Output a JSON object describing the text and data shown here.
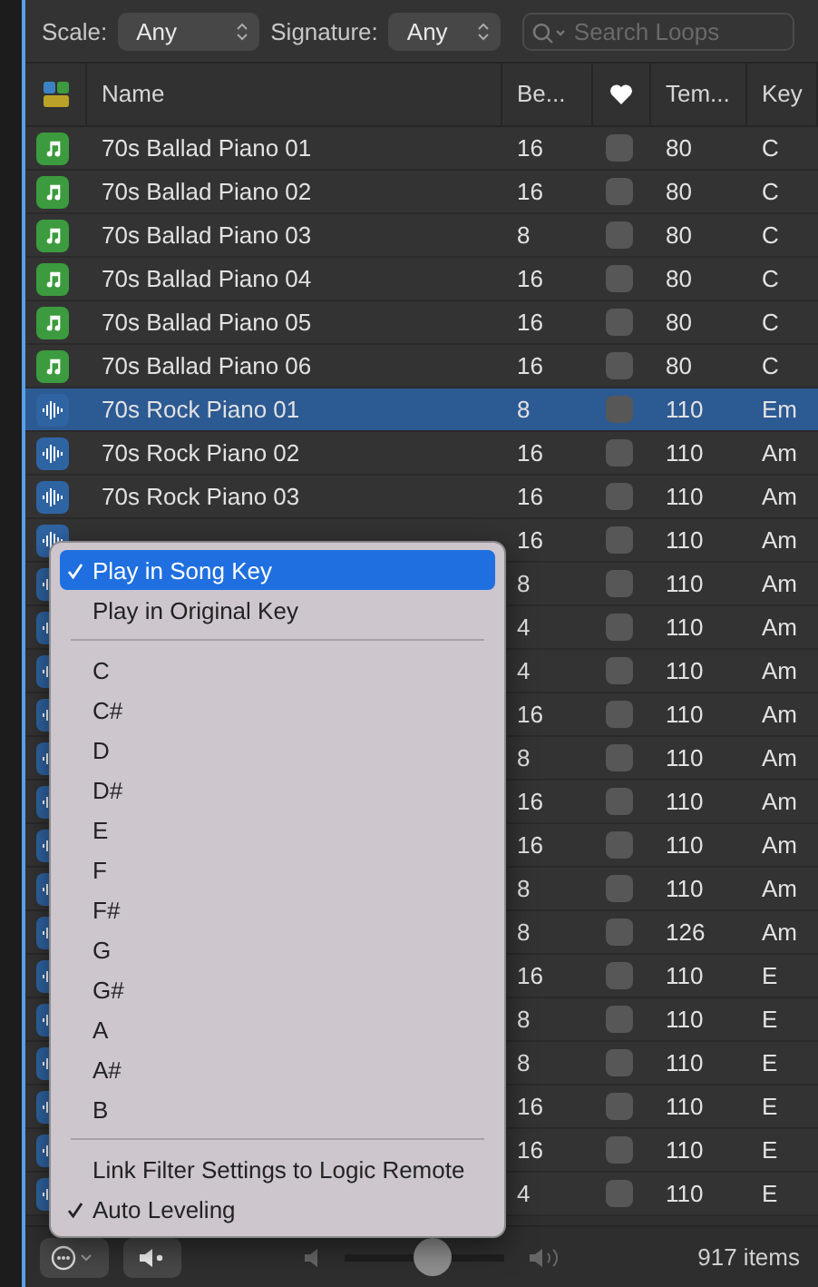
{
  "filters": {
    "scale_label": "Scale:",
    "scale_value": "Any",
    "signature_label": "Signature:",
    "signature_value": "Any",
    "search": {
      "placeholder": "Search Loops"
    }
  },
  "columns": [
    "Name",
    "Be...",
    "Tem...",
    "Key"
  ],
  "rows": [
    {
      "kind": "midi",
      "name": "70s Ballad Piano 01",
      "beats": "16",
      "favorite": false,
      "tempo": "80",
      "key": "C",
      "selected": false
    },
    {
      "kind": "midi",
      "name": "70s Ballad Piano 02",
      "beats": "16",
      "favorite": false,
      "tempo": "80",
      "key": "C",
      "selected": false
    },
    {
      "kind": "midi",
      "name": "70s Ballad Piano 03",
      "beats": "8",
      "favorite": false,
      "tempo": "80",
      "key": "C",
      "selected": false
    },
    {
      "kind": "midi",
      "name": "70s Ballad Piano 04",
      "beats": "16",
      "favorite": false,
      "tempo": "80",
      "key": "C",
      "selected": false
    },
    {
      "kind": "midi",
      "name": "70s Ballad Piano 05",
      "beats": "16",
      "favorite": false,
      "tempo": "80",
      "key": "C",
      "selected": false
    },
    {
      "kind": "midi",
      "name": "70s Ballad Piano 06",
      "beats": "16",
      "favorite": false,
      "tempo": "80",
      "key": "C",
      "selected": false
    },
    {
      "kind": "audio",
      "name": "70s Rock Piano 01",
      "beats": "8",
      "favorite": false,
      "tempo": "110",
      "key": "Em",
      "selected": true
    },
    {
      "kind": "audio",
      "name": "70s Rock Piano 02",
      "beats": "16",
      "favorite": false,
      "tempo": "110",
      "key": "Am",
      "selected": false
    },
    {
      "kind": "audio",
      "name": "70s Rock Piano 03",
      "beats": "16",
      "favorite": false,
      "tempo": "110",
      "key": "Am",
      "selected": false
    },
    {
      "kind": "audio",
      "beats": "16",
      "favorite": false,
      "tempo": "110",
      "key": "Am",
      "selected": false
    },
    {
      "kind": "audio",
      "beats": "8",
      "favorite": false,
      "tempo": "110",
      "key": "Am",
      "selected": false
    },
    {
      "kind": "audio",
      "beats": "4",
      "favorite": false,
      "tempo": "110",
      "key": "Am",
      "selected": false
    },
    {
      "kind": "audio",
      "beats": "4",
      "favorite": false,
      "tempo": "110",
      "key": "Am",
      "selected": false
    },
    {
      "kind": "audio",
      "beats": "16",
      "favorite": false,
      "tempo": "110",
      "key": "Am",
      "selected": false
    },
    {
      "kind": "audio",
      "beats": "8",
      "favorite": false,
      "tempo": "110",
      "key": "Am",
      "selected": false
    },
    {
      "kind": "audio",
      "beats": "16",
      "favorite": false,
      "tempo": "110",
      "key": "Am",
      "selected": false
    },
    {
      "kind": "audio",
      "beats": "16",
      "favorite": false,
      "tempo": "110",
      "key": "Am",
      "selected": false
    },
    {
      "kind": "audio",
      "beats": "8",
      "favorite": false,
      "tempo": "110",
      "key": "Am",
      "selected": false
    },
    {
      "kind": "audio",
      "beats": "8",
      "favorite": false,
      "tempo": "126",
      "key": "Am",
      "selected": false
    },
    {
      "kind": "audio",
      "beats": "16",
      "favorite": false,
      "tempo": "110",
      "key": "E",
      "selected": false
    },
    {
      "kind": "audio",
      "beats": "8",
      "favorite": false,
      "tempo": "110",
      "key": "E",
      "selected": false
    },
    {
      "kind": "audio",
      "beats": "8",
      "favorite": false,
      "tempo": "110",
      "key": "E",
      "selected": false
    },
    {
      "kind": "audio",
      "beats": "16",
      "favorite": false,
      "tempo": "110",
      "key": "E",
      "selected": false
    },
    {
      "kind": "audio",
      "beats": "16",
      "favorite": false,
      "tempo": "110",
      "key": "E",
      "selected": false
    },
    {
      "kind": "audio",
      "beats": "4",
      "favorite": false,
      "tempo": "110",
      "key": "E",
      "selected": false
    }
  ],
  "menu": [
    {
      "kind": "item",
      "label": "Play in Song Key",
      "checked": true,
      "selected": true
    },
    {
      "kind": "item",
      "label": "Play in Original Key",
      "checked": false,
      "selected": false
    },
    {
      "kind": "separator"
    },
    {
      "kind": "item",
      "label": "C",
      "checked": false,
      "selected": false
    },
    {
      "kind": "item",
      "label": "C#",
      "checked": false,
      "selected": false
    },
    {
      "kind": "item",
      "label": "D",
      "checked": false,
      "selected": false
    },
    {
      "kind": "item",
      "label": "D#",
      "checked": false,
      "selected": false
    },
    {
      "kind": "item",
      "label": "E",
      "checked": false,
      "selected": false
    },
    {
      "kind": "item",
      "label": "F",
      "checked": false,
      "selected": false
    },
    {
      "kind": "item",
      "label": "F#",
      "checked": false,
      "selected": false
    },
    {
      "kind": "item",
      "label": "G",
      "checked": false,
      "selected": false
    },
    {
      "kind": "item",
      "label": "G#",
      "checked": false,
      "selected": false
    },
    {
      "kind": "item",
      "label": "A",
      "checked": false,
      "selected": false
    },
    {
      "kind": "item",
      "label": "A#",
      "checked": false,
      "selected": false
    },
    {
      "kind": "item",
      "label": "B",
      "checked": false,
      "selected": false
    },
    {
      "kind": "separator"
    },
    {
      "kind": "item",
      "label": "Link Filter Settings to Logic Remote",
      "checked": false,
      "selected": false
    },
    {
      "kind": "item",
      "label": "Auto Leveling",
      "checked": true,
      "selected": false
    }
  ],
  "footer": {
    "volume": {
      "level": 0.55
    },
    "count": "917 items"
  }
}
